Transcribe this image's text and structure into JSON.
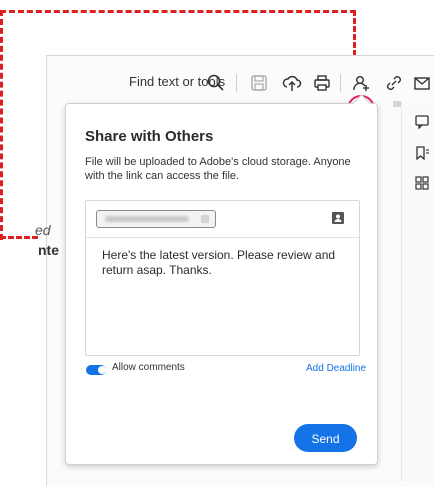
{
  "toolbar": {
    "find_label": "Find text or tools",
    "icons": [
      "search-icon",
      "save-icon",
      "upload-icon",
      "print-icon",
      "share-user-icon",
      "link-icon",
      "mail-icon"
    ]
  },
  "document": {
    "fragment_1": "ed",
    "fragment_2": "nte"
  },
  "rail": {
    "icons": [
      "comment-icon",
      "bookmark-icon",
      "grid-icon"
    ]
  },
  "dialog": {
    "title": "Share with Others",
    "description": "File will be uploaded to Adobe's cloud storage. Anyone with the link can access the file.",
    "message": "Here's the latest version. Please review and return asap. Thanks.",
    "allow_comments_label": "Allow comments",
    "allow_comments_on": true,
    "add_deadline_label": "Add Deadline",
    "send_label": "Send"
  },
  "colors": {
    "accent": "#1473e6",
    "highlight": "#e0245e",
    "annotation": "#dc1f1f"
  }
}
